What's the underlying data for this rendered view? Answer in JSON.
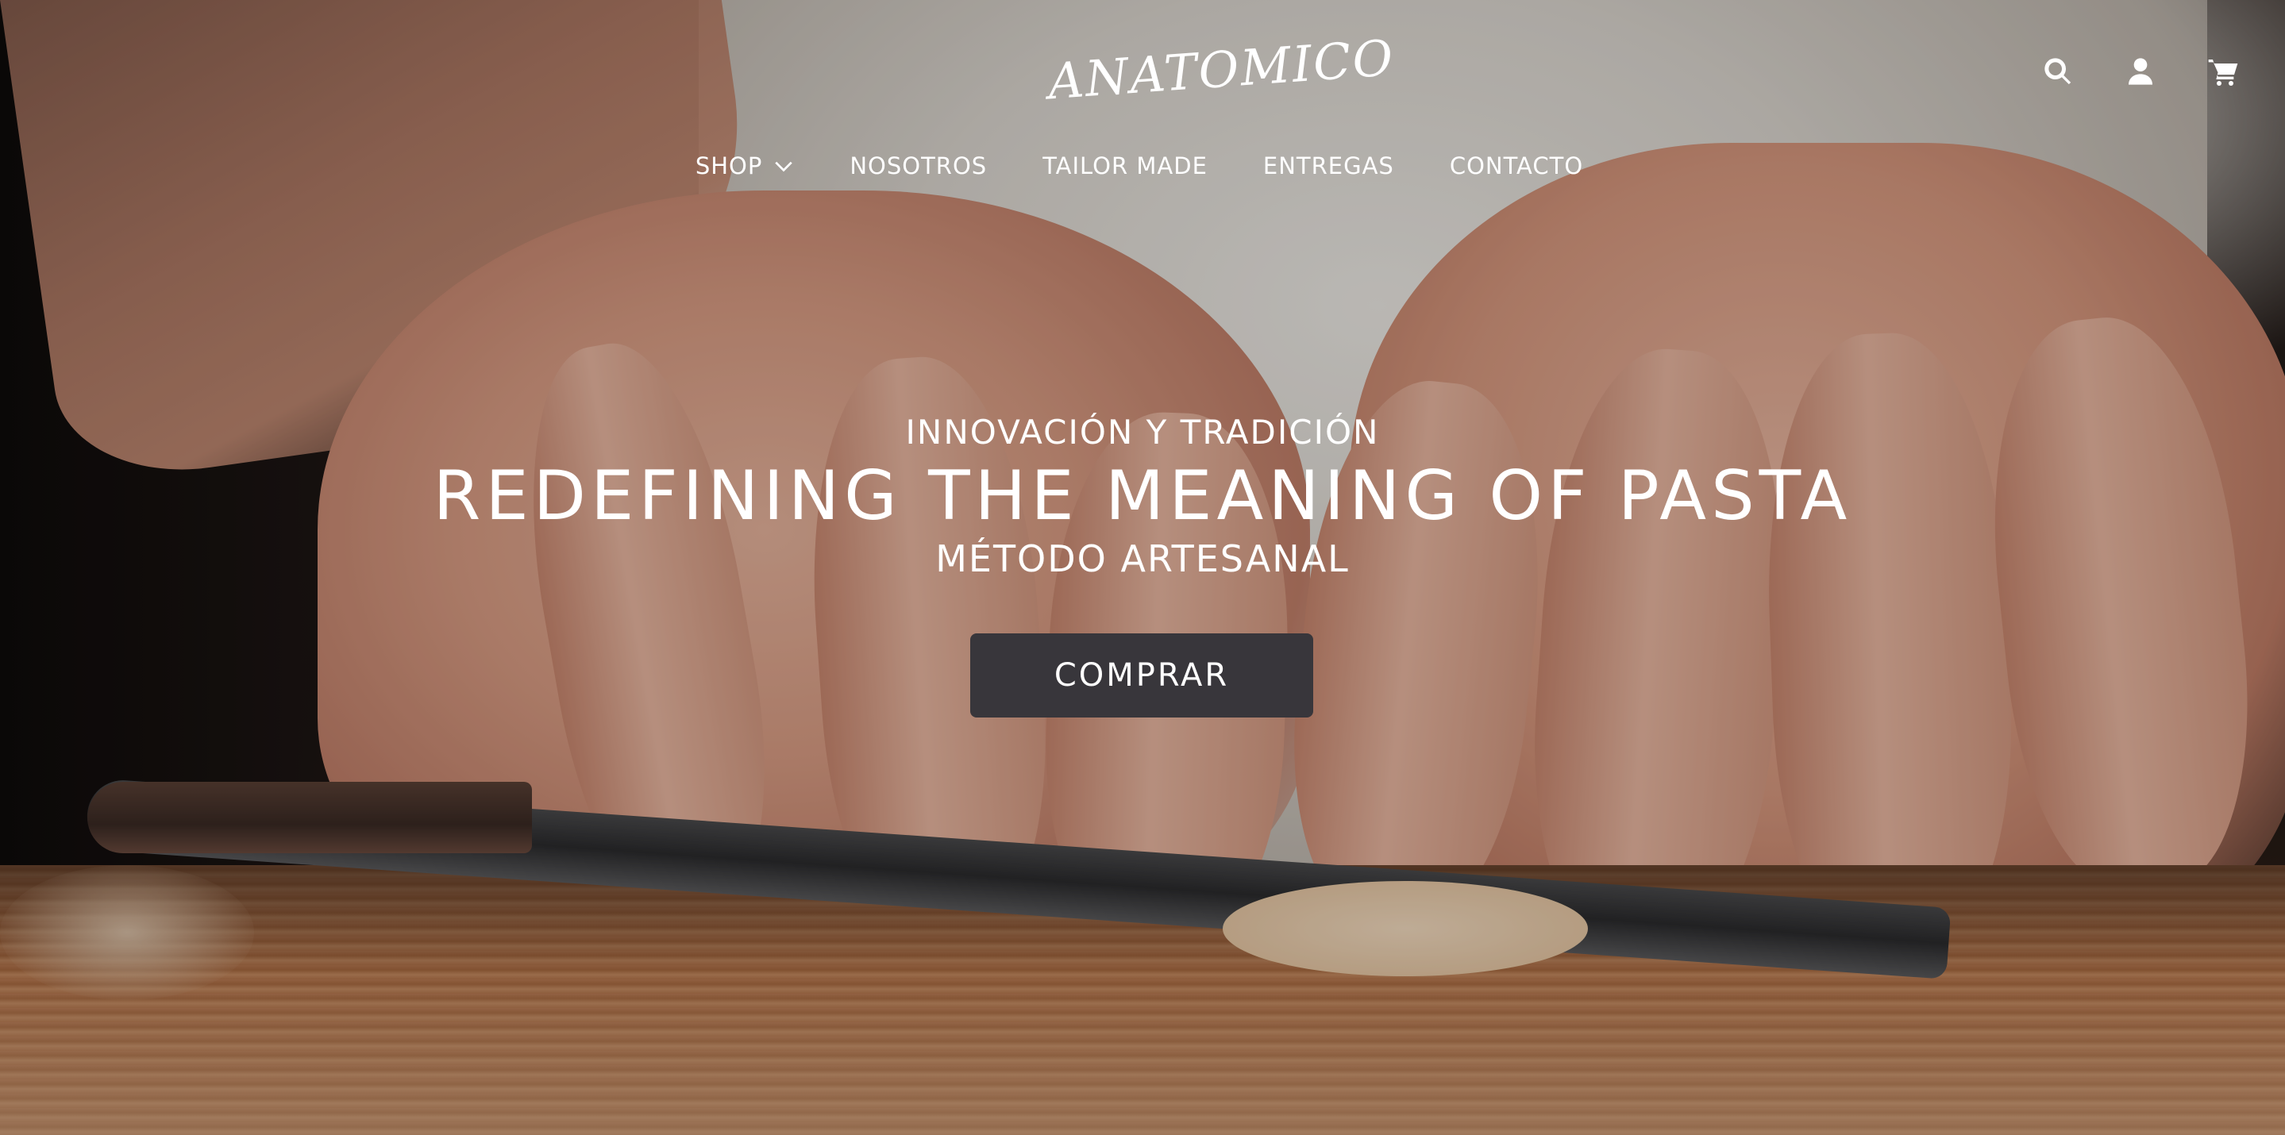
{
  "brand": {
    "logo_text": "ANATOMICO"
  },
  "header": {
    "icons": [
      "search-icon",
      "user-icon",
      "cart-icon"
    ]
  },
  "nav": {
    "items": [
      {
        "label": "SHOP",
        "has_dropdown": true
      },
      {
        "label": "NOSOTROS"
      },
      {
        "label": "TAILOR MADE"
      },
      {
        "label": "ENTREGAS"
      },
      {
        "label": "CONTACTO"
      }
    ]
  },
  "hero": {
    "kicker": "INNOVACIÓN Y TRADICIÓN",
    "headline": "REDEFINING THE MEANING OF PASTA",
    "subheadline": "MÉTODO ARTESANAL",
    "cta_label": "COMPRAR",
    "background_image": "hands-shaping-pasta-dough-on-wooden-board"
  },
  "colors": {
    "text": "#ffffff",
    "cta_background": "#38363b"
  }
}
